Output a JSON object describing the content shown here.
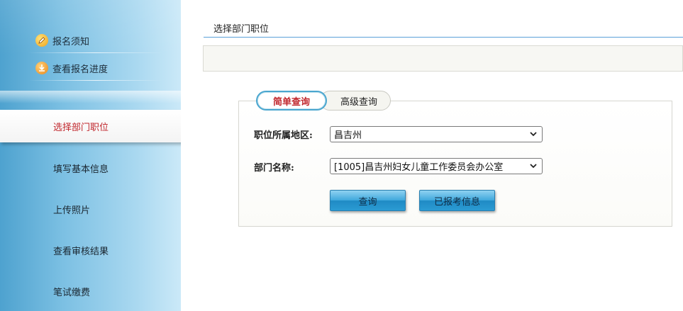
{
  "sidebar": {
    "top_links": [
      {
        "label": "报名须知",
        "icon": "pencil-icon"
      },
      {
        "label": "查看报名进度",
        "icon": "download-icon"
      }
    ],
    "steps": [
      {
        "label": "选择部门职位",
        "active": true
      },
      {
        "label": "填写基本信息",
        "active": false
      },
      {
        "label": "上传照片",
        "active": false
      },
      {
        "label": "查看审核结果",
        "active": false
      },
      {
        "label": "笔试缴费",
        "active": false
      }
    ]
  },
  "main": {
    "title": "选择部门职位",
    "tabs": [
      {
        "label": "简单查询",
        "active": true
      },
      {
        "label": "高级查询",
        "active": false
      }
    ],
    "form": {
      "region_label": "职位所属地区:",
      "region_value": "昌吉州",
      "department_label": "部门名称:",
      "department_value": "[1005]昌吉州妇女儿童工作委员会办公室"
    },
    "buttons": {
      "query": "查询",
      "registered_info": "已报考信息"
    }
  },
  "colors": {
    "active_text": "#c0262c",
    "accent_line": "#5aa1d8",
    "button_blue": "#3ea7dc"
  }
}
